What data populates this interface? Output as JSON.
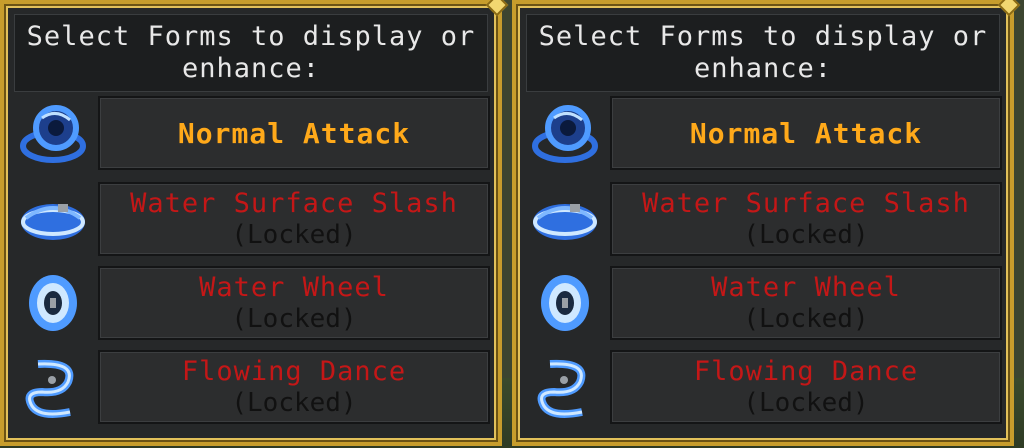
{
  "panels": [
    {
      "header": "Select Forms to display or enhance:",
      "forms": [
        {
          "name": "Normal Attack",
          "status": "",
          "icon": "swirl-slash-icon"
        },
        {
          "name": "Water Surface Slash",
          "status": "(Locked)",
          "icon": "water-wave-icon"
        },
        {
          "name": "Water Wheel",
          "status": "(Locked)",
          "icon": "water-wheel-icon"
        },
        {
          "name": "Flowing Dance",
          "status": "(Locked)",
          "icon": "flowing-dance-icon"
        }
      ]
    },
    {
      "header": "Select Forms to display or enhance:",
      "forms": [
        {
          "name": "Normal Attack",
          "status": "",
          "icon": "swirl-slash-icon"
        },
        {
          "name": "Water Surface Slash",
          "status": "(Locked)",
          "icon": "water-wave-icon"
        },
        {
          "name": "Water Wheel",
          "status": "(Locked)",
          "icon": "water-wheel-icon"
        },
        {
          "name": "Flowing Dance",
          "status": "(Locked)",
          "icon": "flowing-dance-icon"
        }
      ]
    }
  ],
  "colors": {
    "frame": "#c79d2c",
    "active_text": "#ffa91a",
    "locked_text": "#c41717",
    "locked_sub": "#111111",
    "header_text": "#e8e8e8",
    "water": "#3f8bff"
  }
}
